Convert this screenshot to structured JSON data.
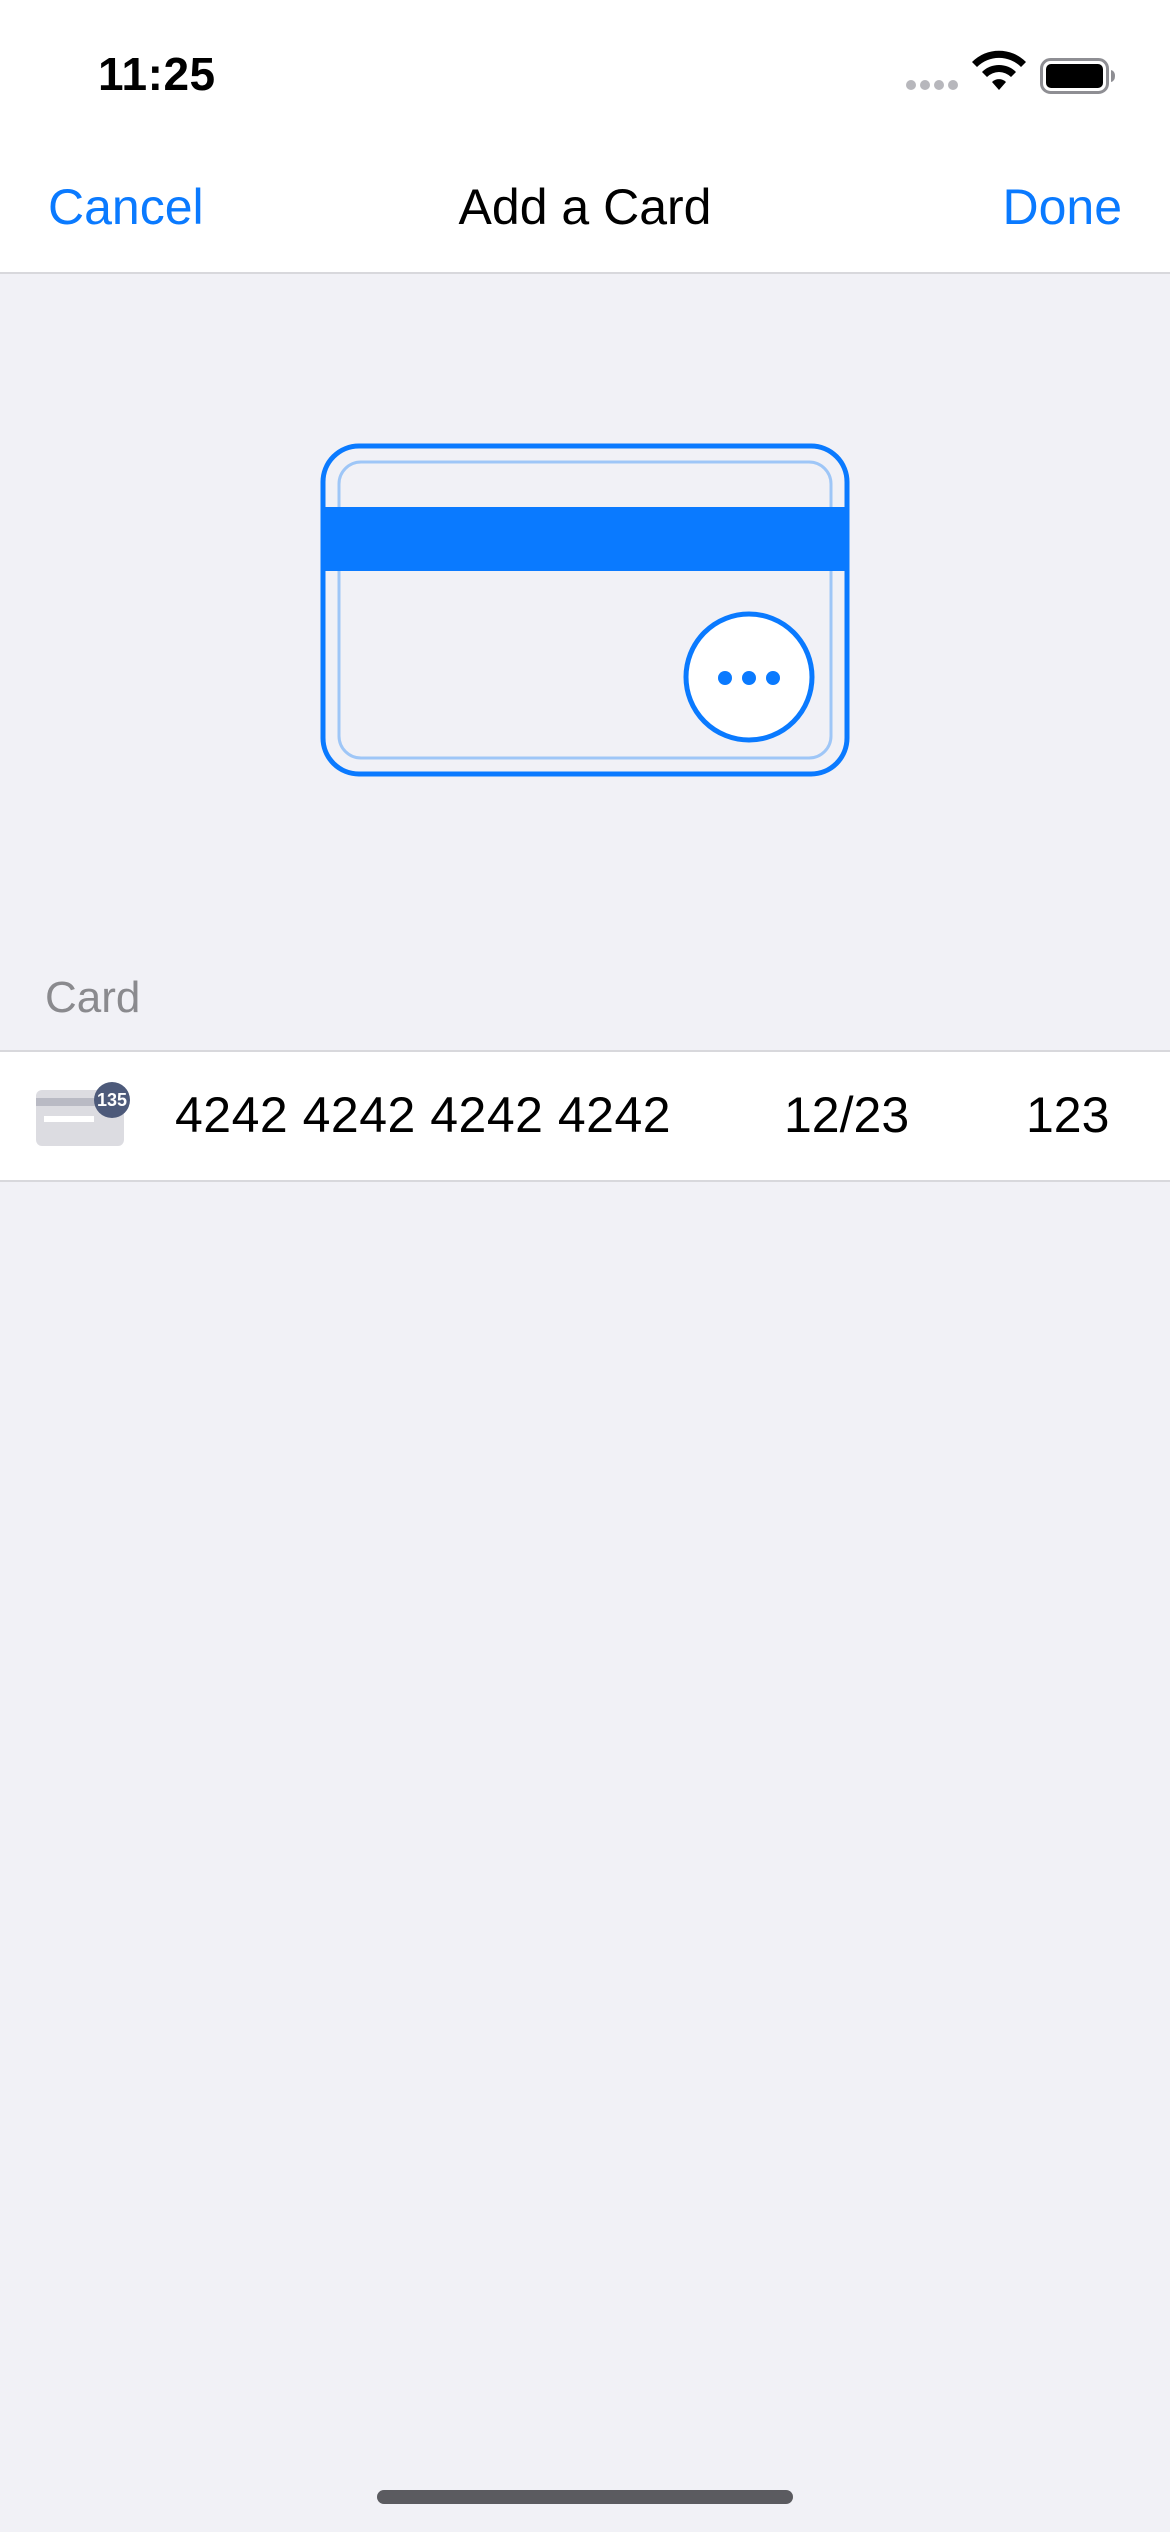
{
  "status_bar": {
    "time": "11:25",
    "icons": [
      "signal-icon",
      "wifi-icon",
      "battery-icon"
    ]
  },
  "nav": {
    "cancel_label": "Cancel",
    "title": "Add a Card",
    "done_label": "Done",
    "accent_color": "#0a7aff"
  },
  "illustration": {
    "icon": "credit-card-icon",
    "stripe_color": "#0a7aff"
  },
  "section": {
    "header": "Card"
  },
  "card_field": {
    "brand_icon": "card-brand-icon",
    "number": "4242 4242 4242 4242",
    "expiry": "12/23",
    "cvc": "123"
  },
  "colors": {
    "background": "#f1f1f6",
    "surface": "#ffffff",
    "accent": "#0a7aff",
    "secondary_text": "#8a8a8e"
  }
}
